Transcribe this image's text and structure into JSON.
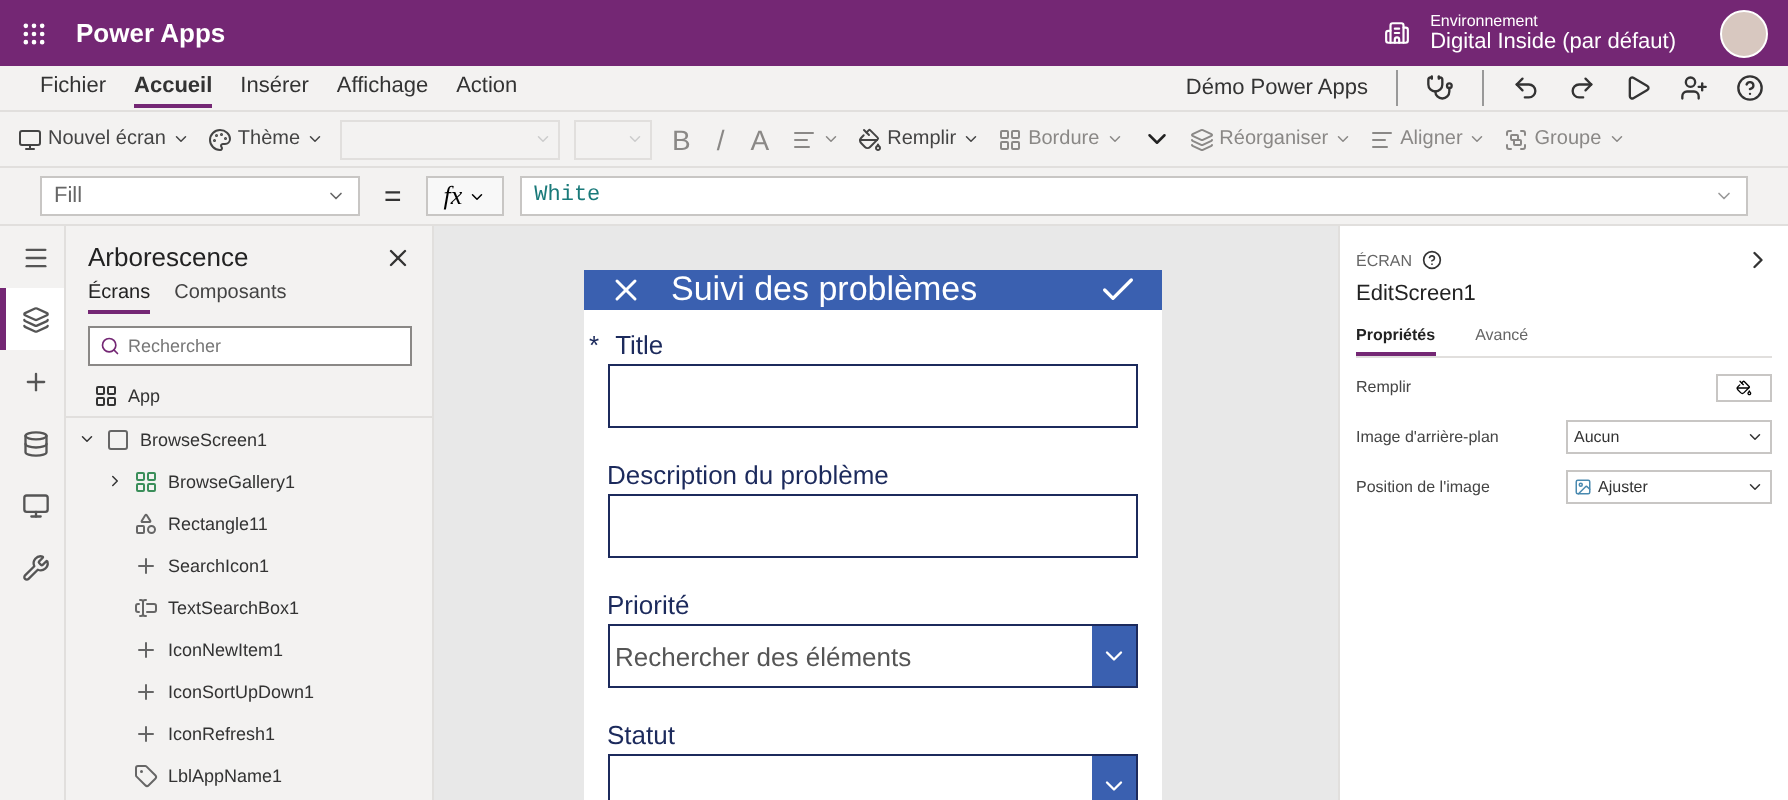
{
  "header": {
    "app_name": "Power Apps",
    "env_label": "Environnement",
    "env_name": "Digital Inside (par défaut)"
  },
  "menu": {
    "tabs": [
      {
        "label": "Fichier",
        "selected": false
      },
      {
        "label": "Accueil",
        "selected": true
      },
      {
        "label": "Insérer",
        "selected": false
      },
      {
        "label": "Affichage",
        "selected": false
      },
      {
        "label": "Action",
        "selected": false
      }
    ],
    "app_title": "Démo Power Apps"
  },
  "toolbar": {
    "items": [
      {
        "kind": "button",
        "label": "Nouvel écran",
        "disabled": false
      },
      {
        "kind": "button",
        "label": "Thème",
        "disabled": false
      },
      {
        "kind": "select",
        "disabled": true
      },
      {
        "kind": "select",
        "disabled": true
      },
      {
        "kind": "glyph",
        "label": "B",
        "disabled": true
      },
      {
        "kind": "glyph",
        "label": "/",
        "disabled": true
      },
      {
        "kind": "glyph",
        "label": "A",
        "disabled": true
      },
      {
        "kind": "button",
        "disabled": true
      },
      {
        "kind": "button",
        "label": "Remplir",
        "disabled": false
      },
      {
        "kind": "button",
        "label": "Bordure",
        "disabled": true
      },
      {
        "kind": "more",
        "disabled": false
      },
      {
        "kind": "button",
        "label": "Réorganiser",
        "disabled": true
      },
      {
        "kind": "button",
        "label": "Aligner",
        "disabled": true
      },
      {
        "kind": "button",
        "label": "Groupe",
        "disabled": true
      }
    ]
  },
  "formula": {
    "property": "Fill",
    "equals": "=",
    "fx": "fx",
    "value": "White"
  },
  "rail": [
    {
      "selected": false
    },
    {
      "selected": true
    },
    {
      "selected": false
    },
    {
      "selected": false
    },
    {
      "selected": false
    },
    {
      "selected": false
    }
  ],
  "tree": {
    "title": "Arborescence",
    "tabs": [
      {
        "label": "Écrans",
        "selected": true
      },
      {
        "label": "Composants",
        "selected": false
      }
    ],
    "search": {
      "placeholder": "Rechercher"
    },
    "app_item": "App",
    "items": [
      {
        "label": "BrowseScreen1",
        "kind": "screen",
        "expanded": true,
        "children": [
          {
            "label": "BrowseGallery1",
            "kind": "gallery",
            "expanded": false
          },
          {
            "label": "Rectangle11",
            "kind": "shape"
          },
          {
            "label": "SearchIcon1",
            "kind": "icon"
          },
          {
            "label": "TextSearchBox1",
            "kind": "input"
          },
          {
            "label": "IconNewItem1",
            "kind": "icon"
          },
          {
            "label": "IconSortUpDown1",
            "kind": "icon"
          },
          {
            "label": "IconRefresh1",
            "kind": "icon"
          },
          {
            "label": "LblAppName1",
            "kind": "label"
          }
        ]
      }
    ]
  },
  "form": {
    "title": "Suivi des problèmes",
    "required_mark": "*",
    "fields": [
      {
        "label": "Title",
        "required": true,
        "kind": "text"
      },
      {
        "label": "Description du problème",
        "required": false,
        "kind": "text"
      },
      {
        "label": "Priorité",
        "required": false,
        "kind": "dropdown",
        "placeholder": "Rechercher des éléments"
      },
      {
        "label": "Statut",
        "required": false,
        "kind": "dropdown"
      }
    ]
  },
  "properties": {
    "section": "ÉCRAN",
    "name": "EditScreen1",
    "tabs": [
      {
        "label": "Propriétés",
        "selected": true
      },
      {
        "label": "Avancé",
        "selected": false
      }
    ],
    "rows": [
      {
        "label": "Remplir",
        "kind": "color"
      },
      {
        "label": "Image d'arrière-plan",
        "kind": "select",
        "value": "Aucun"
      },
      {
        "label": "Position de l'image",
        "kind": "select",
        "value": "Ajuster"
      }
    ]
  }
}
